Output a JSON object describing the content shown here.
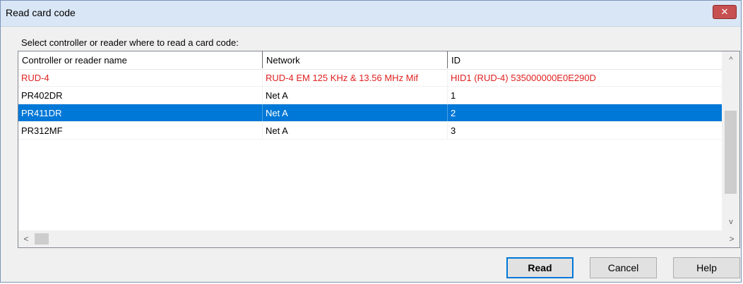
{
  "window": {
    "title": "Read card code",
    "close_glyph": "✕"
  },
  "prompt": "Select controller or reader where to read a card code:",
  "table": {
    "columns": [
      "Controller or reader name",
      "Network",
      "ID"
    ],
    "rows": [
      {
        "name": "RUD-4",
        "network": "RUD-4 EM 125 KHz & 13.56 MHz Mif",
        "id": "HID1 (RUD-4) 535000000E0E290D",
        "style": "red"
      },
      {
        "name": "PR402DR",
        "network": "Net A",
        "id": "1",
        "style": "normal"
      },
      {
        "name": "PR411DR",
        "network": "Net A",
        "id": "2",
        "style": "selected"
      },
      {
        "name": "PR312MF",
        "network": "Net A",
        "id": "3",
        "style": "normal"
      }
    ]
  },
  "scrollbars": {
    "up_glyph": "^",
    "down_glyph": "v",
    "left_glyph": "<",
    "right_glyph": ">"
  },
  "buttons": {
    "read": "Read",
    "cancel": "Cancel",
    "help": "Help"
  },
  "colors": {
    "selection": "#0078d7",
    "highlight_text": "#e02020",
    "close_button": "#c75050"
  }
}
